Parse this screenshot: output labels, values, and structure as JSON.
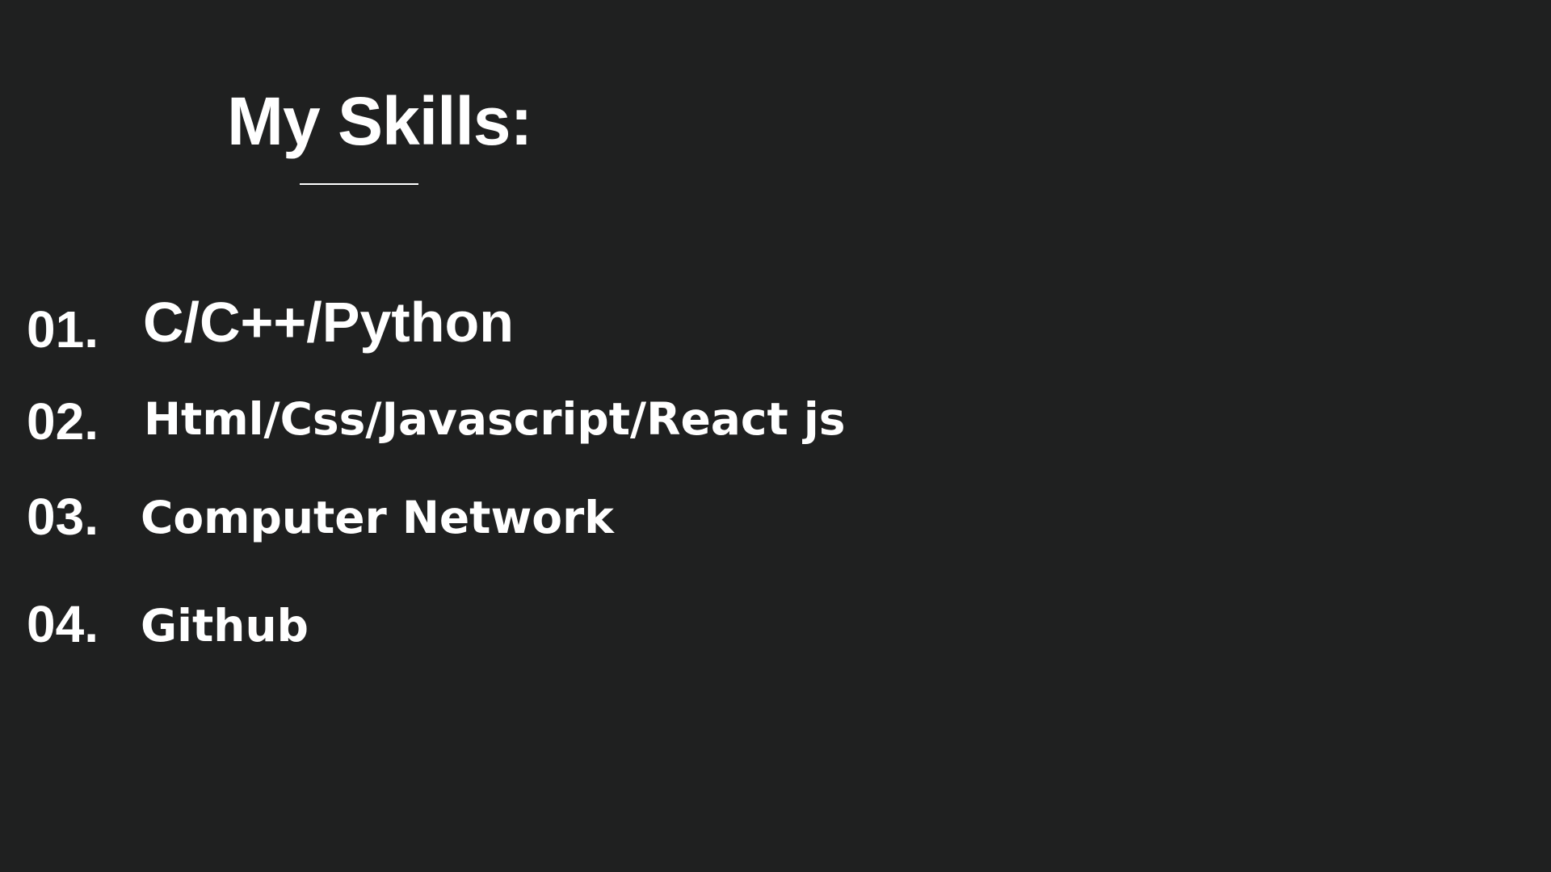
{
  "slide": {
    "title": "My Skills:",
    "skills": [
      {
        "number": "01.",
        "label": "C/C++/Python"
      },
      {
        "number": "02.",
        "label": "Html/Css/Javascript/React js"
      },
      {
        "number": "03.",
        "label": "Computer Network"
      },
      {
        "number": "04.",
        "label": "Github"
      }
    ]
  },
  "colors": {
    "background": "#1f2020",
    "text": "#ffffff"
  }
}
